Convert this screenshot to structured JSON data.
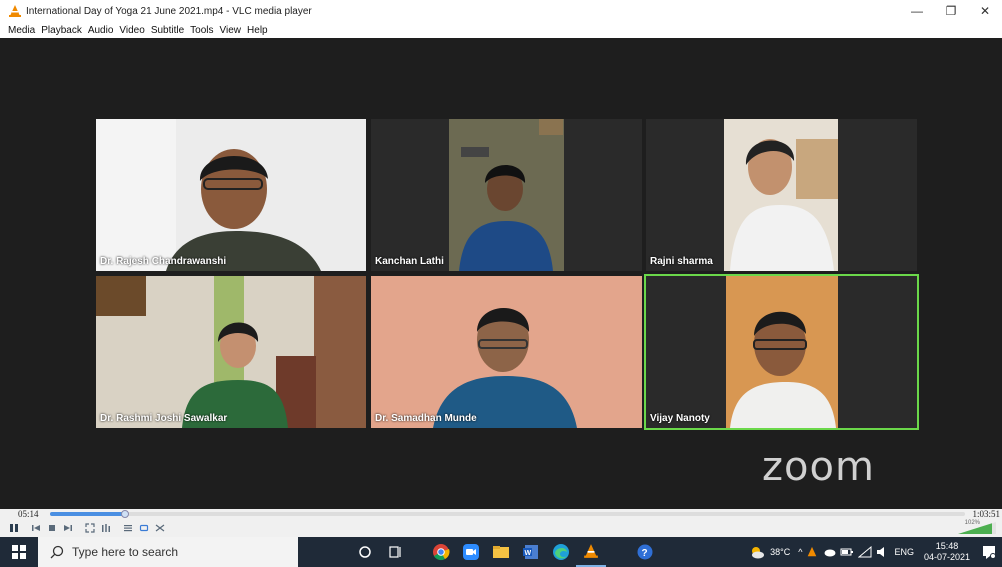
{
  "window": {
    "title": "International Day of Yoga 21 June 2021.mp4 - VLC media player",
    "minimize_glyph": "—",
    "maximize_glyph": "❐",
    "close_glyph": "✕"
  },
  "menu": [
    "Media",
    "Playback",
    "Audio",
    "Video",
    "Subtitle",
    "Tools",
    "View",
    "Help"
  ],
  "participants": [
    {
      "name": "Dr. Rajesh Chandrawanshi",
      "active": false
    },
    {
      "name": "Kanchan Lathi",
      "active": false
    },
    {
      "name": "Rajni sharma",
      "active": false
    },
    {
      "name": "Dr. Rashmi Joshi Sawalkar",
      "active": false
    },
    {
      "name": "Dr. Samadhan Munde",
      "active": false
    },
    {
      "name": "Vijay Nanoty",
      "active": true
    }
  ],
  "zoom_logo": "zoom",
  "playback": {
    "elapsed": "05:14",
    "total": "1:03:51",
    "progress": 0.082
  },
  "volume": {
    "label": "102%"
  },
  "taskbar": {
    "search_placeholder": "Type here to search",
    "weather": "38°C",
    "language": "ENG",
    "time": "15:48",
    "date": "04-07-2021"
  }
}
